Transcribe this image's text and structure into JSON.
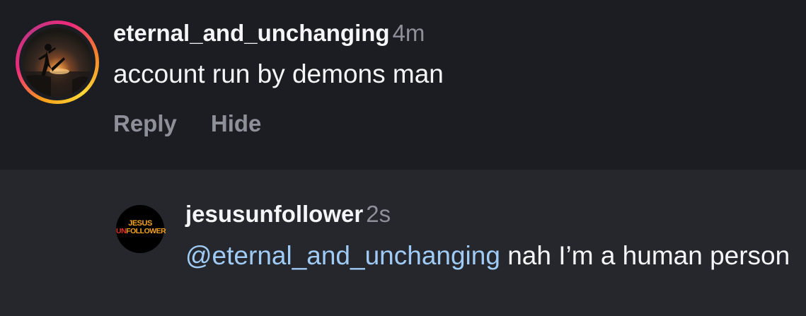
{
  "comment": {
    "username": "eternal_and_unchanging",
    "time": "4m",
    "text": "account run by demons man",
    "actions": {
      "reply": "Reply",
      "hide": "Hide"
    }
  },
  "reply": {
    "username": "jesusunfollower",
    "time": "2s",
    "mention": "@eternal_and_unchanging",
    "text": " nah I’m a human person",
    "avatar_logo": {
      "line1": "JESUS",
      "line2_red": "UN",
      "line2_rest": "FOLLOWER"
    }
  },
  "colors": {
    "background": "#1c1d22",
    "reply_background": "#25272d",
    "mention": "#9fcbf5",
    "secondary_text": "#8e9099"
  }
}
